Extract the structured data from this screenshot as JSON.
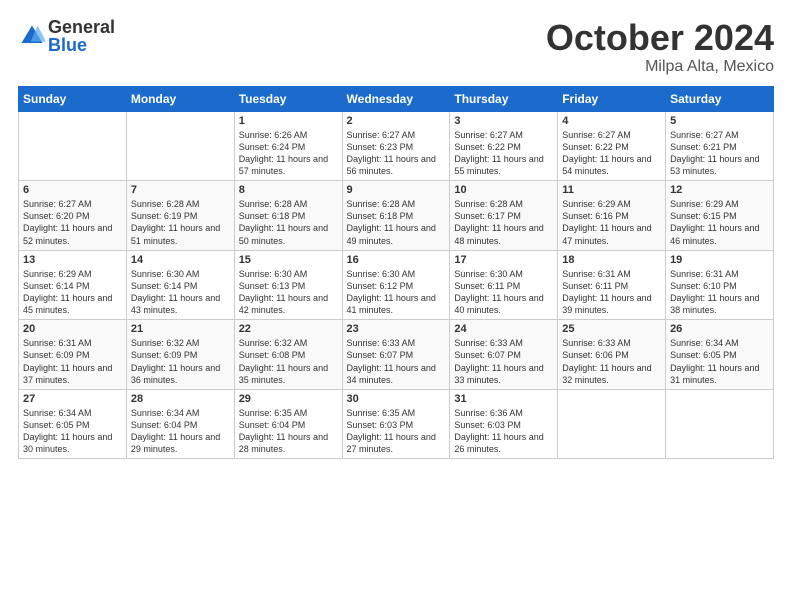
{
  "logo": {
    "general": "General",
    "blue": "Blue"
  },
  "header": {
    "month": "October 2024",
    "location": "Milpa Alta, Mexico"
  },
  "days": [
    "Sunday",
    "Monday",
    "Tuesday",
    "Wednesday",
    "Thursday",
    "Friday",
    "Saturday"
  ],
  "weeks": [
    [
      {
        "num": "",
        "sunrise": "",
        "sunset": "",
        "daylight": ""
      },
      {
        "num": "",
        "sunrise": "",
        "sunset": "",
        "daylight": ""
      },
      {
        "num": "1",
        "sunrise": "Sunrise: 6:26 AM",
        "sunset": "Sunset: 6:24 PM",
        "daylight": "Daylight: 11 hours and 57 minutes."
      },
      {
        "num": "2",
        "sunrise": "Sunrise: 6:27 AM",
        "sunset": "Sunset: 6:23 PM",
        "daylight": "Daylight: 11 hours and 56 minutes."
      },
      {
        "num": "3",
        "sunrise": "Sunrise: 6:27 AM",
        "sunset": "Sunset: 6:22 PM",
        "daylight": "Daylight: 11 hours and 55 minutes."
      },
      {
        "num": "4",
        "sunrise": "Sunrise: 6:27 AM",
        "sunset": "Sunset: 6:22 PM",
        "daylight": "Daylight: 11 hours and 54 minutes."
      },
      {
        "num": "5",
        "sunrise": "Sunrise: 6:27 AM",
        "sunset": "Sunset: 6:21 PM",
        "daylight": "Daylight: 11 hours and 53 minutes."
      }
    ],
    [
      {
        "num": "6",
        "sunrise": "Sunrise: 6:27 AM",
        "sunset": "Sunset: 6:20 PM",
        "daylight": "Daylight: 11 hours and 52 minutes."
      },
      {
        "num": "7",
        "sunrise": "Sunrise: 6:28 AM",
        "sunset": "Sunset: 6:19 PM",
        "daylight": "Daylight: 11 hours and 51 minutes."
      },
      {
        "num": "8",
        "sunrise": "Sunrise: 6:28 AM",
        "sunset": "Sunset: 6:18 PM",
        "daylight": "Daylight: 11 hours and 50 minutes."
      },
      {
        "num": "9",
        "sunrise": "Sunrise: 6:28 AM",
        "sunset": "Sunset: 6:18 PM",
        "daylight": "Daylight: 11 hours and 49 minutes."
      },
      {
        "num": "10",
        "sunrise": "Sunrise: 6:28 AM",
        "sunset": "Sunset: 6:17 PM",
        "daylight": "Daylight: 11 hours and 48 minutes."
      },
      {
        "num": "11",
        "sunrise": "Sunrise: 6:29 AM",
        "sunset": "Sunset: 6:16 PM",
        "daylight": "Daylight: 11 hours and 47 minutes."
      },
      {
        "num": "12",
        "sunrise": "Sunrise: 6:29 AM",
        "sunset": "Sunset: 6:15 PM",
        "daylight": "Daylight: 11 hours and 46 minutes."
      }
    ],
    [
      {
        "num": "13",
        "sunrise": "Sunrise: 6:29 AM",
        "sunset": "Sunset: 6:14 PM",
        "daylight": "Daylight: 11 hours and 45 minutes."
      },
      {
        "num": "14",
        "sunrise": "Sunrise: 6:30 AM",
        "sunset": "Sunset: 6:14 PM",
        "daylight": "Daylight: 11 hours and 43 minutes."
      },
      {
        "num": "15",
        "sunrise": "Sunrise: 6:30 AM",
        "sunset": "Sunset: 6:13 PM",
        "daylight": "Daylight: 11 hours and 42 minutes."
      },
      {
        "num": "16",
        "sunrise": "Sunrise: 6:30 AM",
        "sunset": "Sunset: 6:12 PM",
        "daylight": "Daylight: 11 hours and 41 minutes."
      },
      {
        "num": "17",
        "sunrise": "Sunrise: 6:30 AM",
        "sunset": "Sunset: 6:11 PM",
        "daylight": "Daylight: 11 hours and 40 minutes."
      },
      {
        "num": "18",
        "sunrise": "Sunrise: 6:31 AM",
        "sunset": "Sunset: 6:11 PM",
        "daylight": "Daylight: 11 hours and 39 minutes."
      },
      {
        "num": "19",
        "sunrise": "Sunrise: 6:31 AM",
        "sunset": "Sunset: 6:10 PM",
        "daylight": "Daylight: 11 hours and 38 minutes."
      }
    ],
    [
      {
        "num": "20",
        "sunrise": "Sunrise: 6:31 AM",
        "sunset": "Sunset: 6:09 PM",
        "daylight": "Daylight: 11 hours and 37 minutes."
      },
      {
        "num": "21",
        "sunrise": "Sunrise: 6:32 AM",
        "sunset": "Sunset: 6:09 PM",
        "daylight": "Daylight: 11 hours and 36 minutes."
      },
      {
        "num": "22",
        "sunrise": "Sunrise: 6:32 AM",
        "sunset": "Sunset: 6:08 PM",
        "daylight": "Daylight: 11 hours and 35 minutes."
      },
      {
        "num": "23",
        "sunrise": "Sunrise: 6:33 AM",
        "sunset": "Sunset: 6:07 PM",
        "daylight": "Daylight: 11 hours and 34 minutes."
      },
      {
        "num": "24",
        "sunrise": "Sunrise: 6:33 AM",
        "sunset": "Sunset: 6:07 PM",
        "daylight": "Daylight: 11 hours and 33 minutes."
      },
      {
        "num": "25",
        "sunrise": "Sunrise: 6:33 AM",
        "sunset": "Sunset: 6:06 PM",
        "daylight": "Daylight: 11 hours and 32 minutes."
      },
      {
        "num": "26",
        "sunrise": "Sunrise: 6:34 AM",
        "sunset": "Sunset: 6:05 PM",
        "daylight": "Daylight: 11 hours and 31 minutes."
      }
    ],
    [
      {
        "num": "27",
        "sunrise": "Sunrise: 6:34 AM",
        "sunset": "Sunset: 6:05 PM",
        "daylight": "Daylight: 11 hours and 30 minutes."
      },
      {
        "num": "28",
        "sunrise": "Sunrise: 6:34 AM",
        "sunset": "Sunset: 6:04 PM",
        "daylight": "Daylight: 11 hours and 29 minutes."
      },
      {
        "num": "29",
        "sunrise": "Sunrise: 6:35 AM",
        "sunset": "Sunset: 6:04 PM",
        "daylight": "Daylight: 11 hours and 28 minutes."
      },
      {
        "num": "30",
        "sunrise": "Sunrise: 6:35 AM",
        "sunset": "Sunset: 6:03 PM",
        "daylight": "Daylight: 11 hours and 27 minutes."
      },
      {
        "num": "31",
        "sunrise": "Sunrise: 6:36 AM",
        "sunset": "Sunset: 6:03 PM",
        "daylight": "Daylight: 11 hours and 26 minutes."
      },
      {
        "num": "",
        "sunrise": "",
        "sunset": "",
        "daylight": ""
      },
      {
        "num": "",
        "sunrise": "",
        "sunset": "",
        "daylight": ""
      }
    ]
  ]
}
